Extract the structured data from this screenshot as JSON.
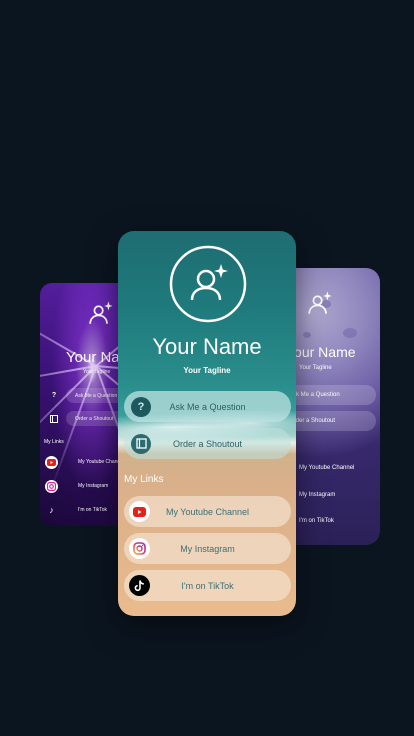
{
  "left_card": {
    "name": "Your Name",
    "tagline": "Your Tagline",
    "buttons": [
      "Ask Me a Question",
      "Order a Shoutout"
    ],
    "my_links_label": "My Links",
    "links": [
      "My Youtube Channel",
      "My Instagram",
      "I'm on TikTok"
    ]
  },
  "center_card": {
    "name": "Your Name",
    "tagline": "Your Tagline",
    "buttons": [
      "Ask Me a Question",
      "Order a Shoutout"
    ],
    "my_links_label": "My Links",
    "links": [
      "My Youtube Channel",
      "My Instagram",
      "I'm on TikTok"
    ]
  },
  "right_card": {
    "name": "Your Name",
    "tagline": "Your Tagline",
    "buttons": [
      "Ask Me a Question",
      "Order a Shoutout"
    ],
    "links": [
      "My Youtube Channel",
      "My Instagram",
      "I'm on TikTok"
    ]
  },
  "icons": [
    "user-profile-icon",
    "question-icon",
    "shoutout-icon",
    "youtube-icon",
    "instagram-icon",
    "tiktok-icon"
  ],
  "colors": {
    "background": "#0b1520",
    "teal_card_top": "#1e6d72",
    "sand": "#e0b48a",
    "purple": "#4a3a86",
    "youtube_red": "#e62117"
  }
}
